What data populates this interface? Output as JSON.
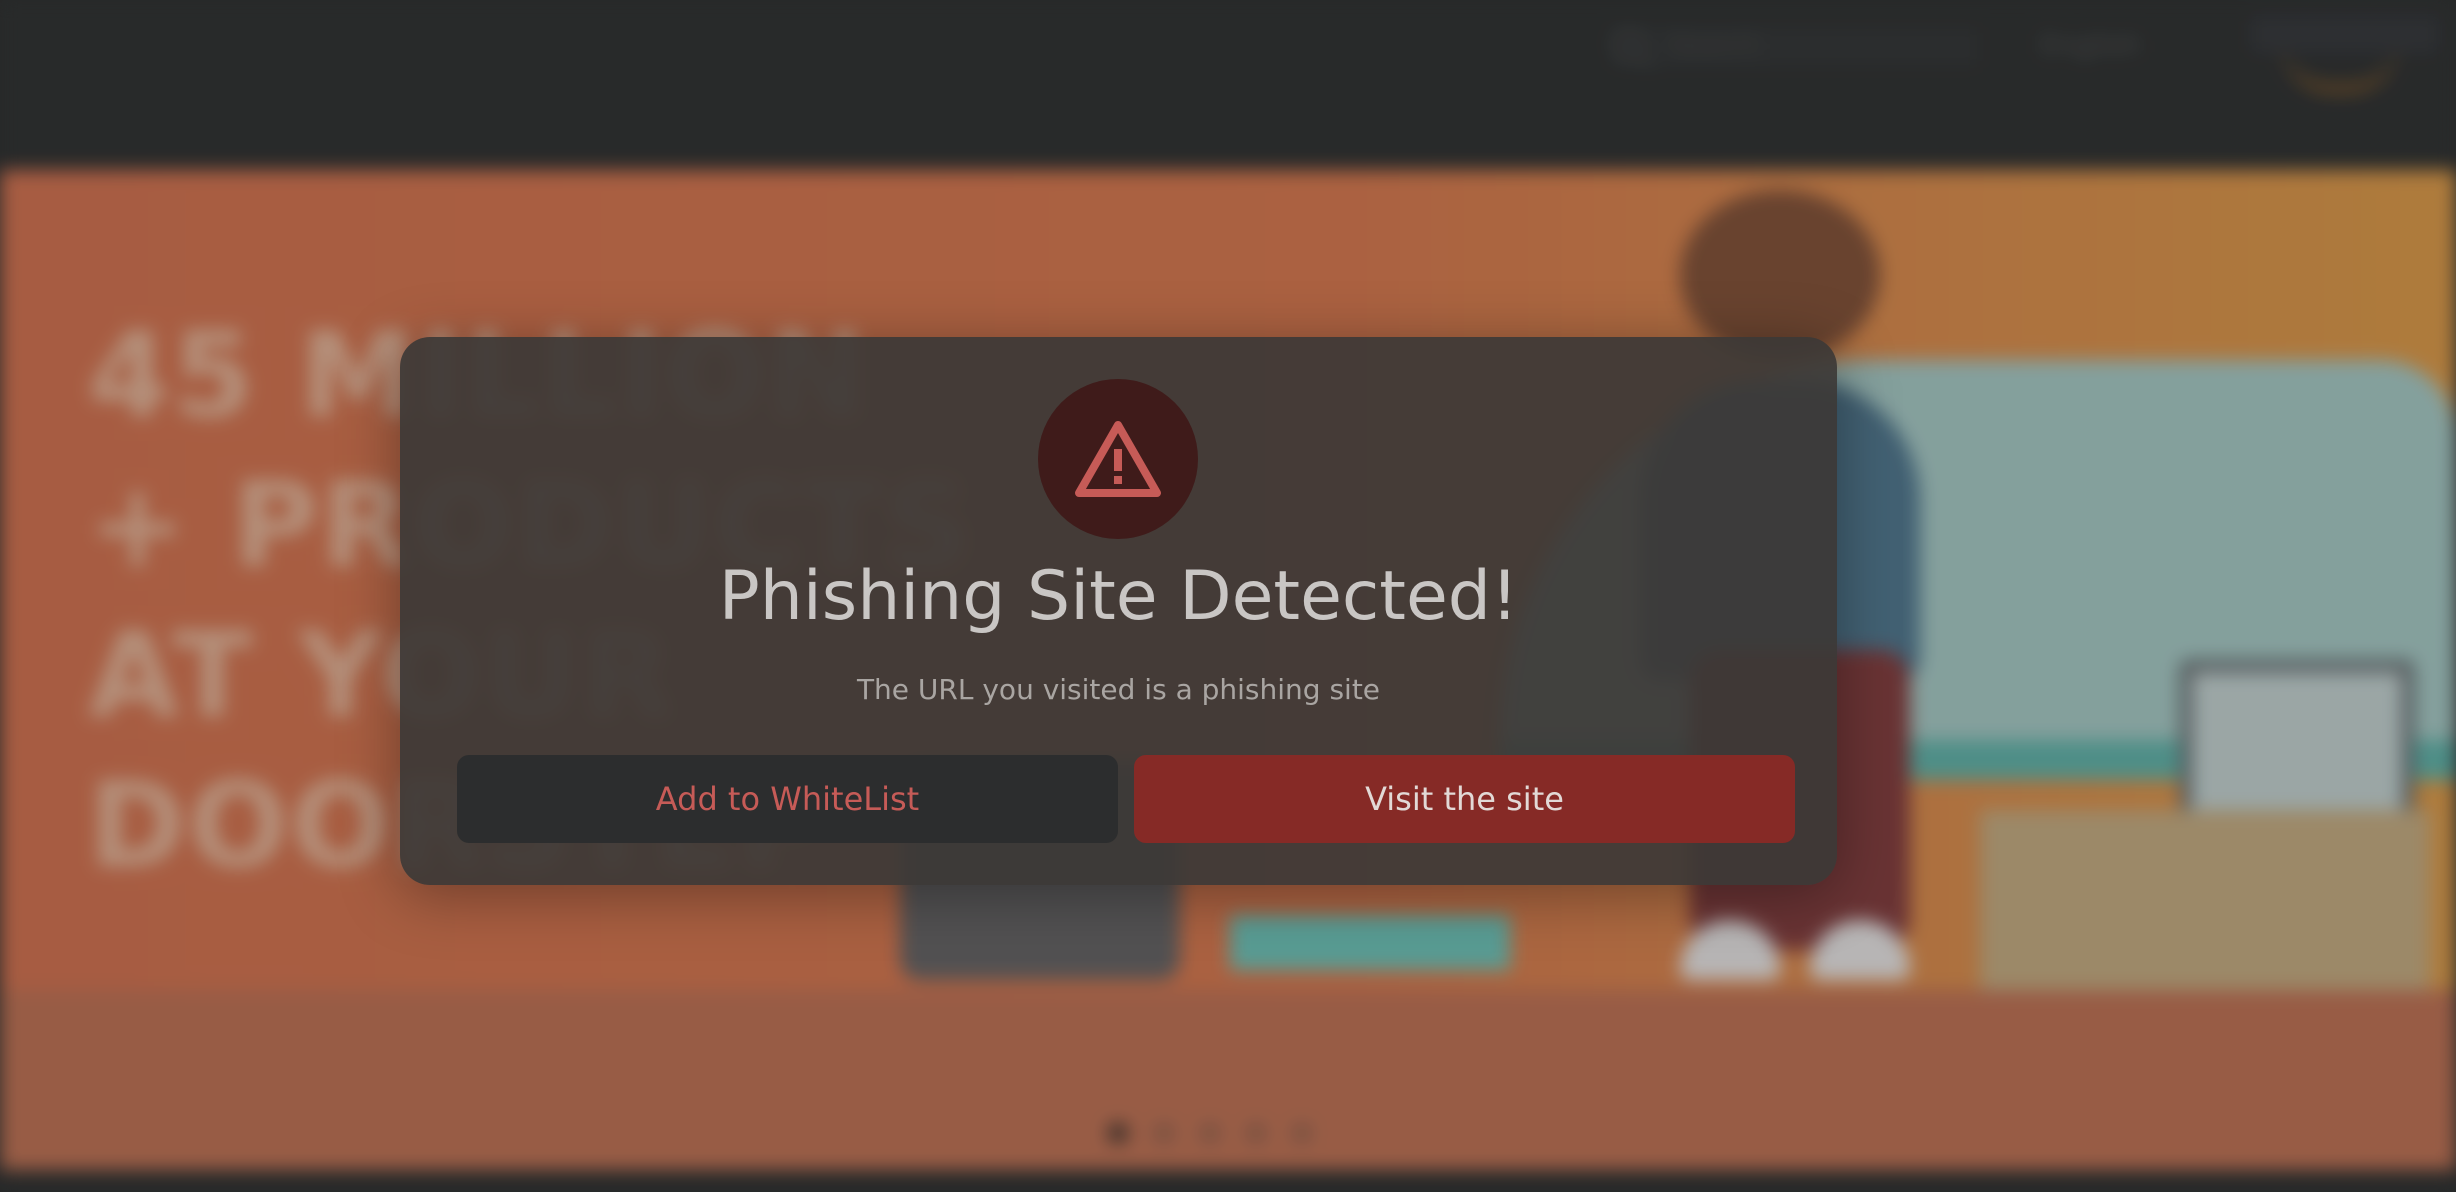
{
  "background_site": {
    "search_placeholder": "Search",
    "language": "English",
    "hero_headline": "45 MILLION + PRODUCTS AT YOUR DOORSTEP",
    "carousel_dots": 5,
    "carousel_active_index": 0
  },
  "dialog": {
    "icon": "warning-triangle-icon",
    "title": "Phishing Site Detected!",
    "message": "The URL you visited is a phishing site",
    "whitelist_button": "Add to WhiteList",
    "visit_button": "Visit the site"
  },
  "colors": {
    "warning_accent": "#c65b57",
    "visit_button_bg": "#862a26",
    "icon_circle_bg": "#3f1b1a"
  }
}
